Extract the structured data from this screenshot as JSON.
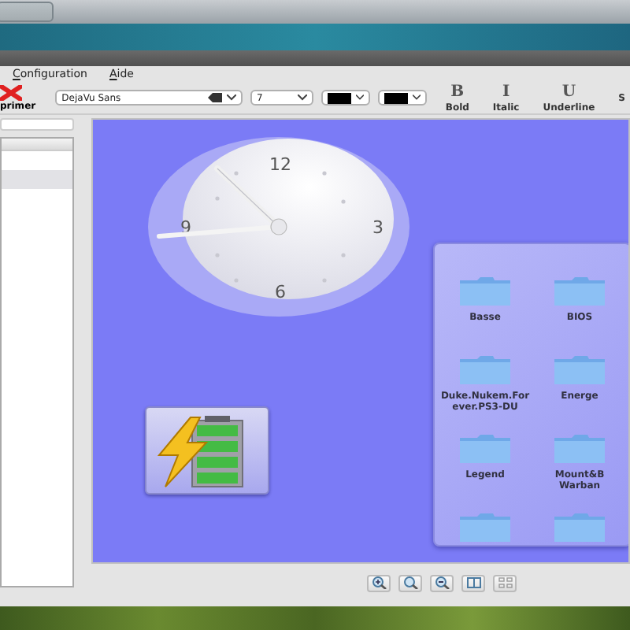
{
  "menu": [
    {
      "label": "Configuration"
    },
    {
      "label": "Aide"
    }
  ],
  "toolbar": {
    "print_label": "primer",
    "font": "DejaVu Sans",
    "size": "7",
    "color_combos": [
      {
        "color": "#000000"
      },
      {
        "color": "#000000"
      }
    ],
    "format_buttons": [
      {
        "glyph": "B",
        "label": "Bold"
      },
      {
        "glyph": "I",
        "label": "Italic"
      },
      {
        "glyph": "U",
        "label": "Underline"
      },
      {
        "label": "S"
      }
    ]
  },
  "sidebar": {
    "rows": [
      {
        "selected": true
      }
    ]
  },
  "clock": {
    "numerals": [
      "12",
      "3",
      "6",
      "9"
    ]
  },
  "battery": {
    "level": 1
  },
  "folders": [
    {
      "kind": "folder",
      "label": "Basse"
    },
    {
      "kind": "folder",
      "label": "BIOS"
    },
    {
      "kind": "folder",
      "label": "Duke.Nukem.Forever.PS3-DU"
    },
    {
      "kind": "folder",
      "label": "Energe"
    },
    {
      "kind": "folder",
      "label": "Legend"
    },
    {
      "kind": "folder",
      "label": "Mount&B Warban"
    },
    {
      "kind": "folder"
    },
    {
      "kind": "folder"
    }
  ],
  "zoom_buttons": [
    {
      "kind": "zoom-in"
    },
    {
      "kind": "zoom-original"
    },
    {
      "kind": "zoom-out"
    },
    {
      "kind": "fit"
    },
    {
      "kind": "grid"
    }
  ]
}
